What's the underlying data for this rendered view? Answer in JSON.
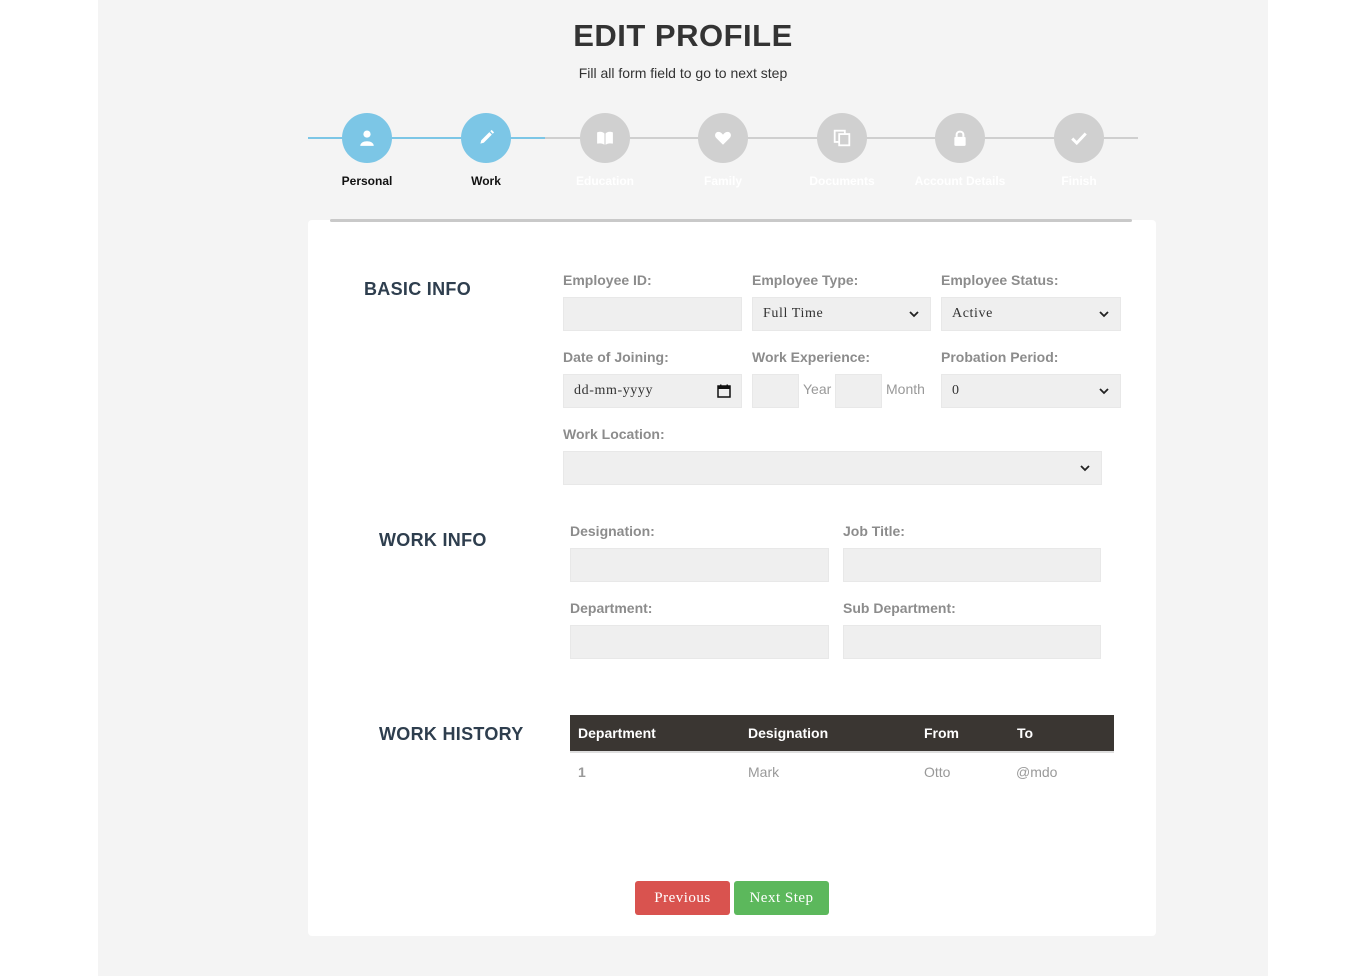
{
  "header": {
    "title": "EDIT PROFILE",
    "subtitle": "Fill all form field to go to next step"
  },
  "steps": [
    {
      "label": "Personal",
      "icon": "user-icon",
      "active": true
    },
    {
      "label": "Work",
      "icon": "pencil-icon",
      "active": true
    },
    {
      "label": "Education",
      "icon": "book-icon",
      "active": false
    },
    {
      "label": "Family",
      "icon": "heart-icon",
      "active": false
    },
    {
      "label": "Documents",
      "icon": "copy-icon",
      "active": false
    },
    {
      "label": "Account Details",
      "icon": "lock-icon",
      "active": false
    },
    {
      "label": "Finish",
      "icon": "check-icon",
      "active": false
    }
  ],
  "basic_info": {
    "title": "BASIC INFO",
    "employee_id_label": "Employee ID:",
    "employee_id_value": "",
    "employee_type_label": "Employee Type:",
    "employee_type_value": "Full Time",
    "employee_status_label": "Employee Status:",
    "employee_status_value": "Active",
    "date_of_joining_label": "Date of Joining:",
    "date_of_joining_placeholder": "dd-mm-yyyy",
    "work_experience_label": "Work Experience:",
    "year_unit": "Year",
    "month_unit": "Month",
    "probation_period_label": "Probation Period:",
    "probation_period_value": "0",
    "work_location_label": "Work Location:",
    "work_location_value": ""
  },
  "work_info": {
    "title": "WORK INFO",
    "designation_label": "Designation:",
    "job_title_label": "Job Title:",
    "department_label": "Department:",
    "sub_department_label": "Sub Department:"
  },
  "work_history": {
    "title": "WORK HISTORY",
    "columns": [
      "Department",
      "Designation",
      "From",
      "To"
    ],
    "rows": [
      [
        "1",
        "Mark",
        "Otto",
        "@mdo"
      ]
    ]
  },
  "buttons": {
    "previous": "Previous",
    "next": "Next Step"
  },
  "colors": {
    "active_step": "#7cc6e6",
    "inactive_step": "#d0d0d0",
    "previous_button": "#d9534f",
    "next_button": "#5cb85c",
    "table_header": "#3a3632"
  }
}
